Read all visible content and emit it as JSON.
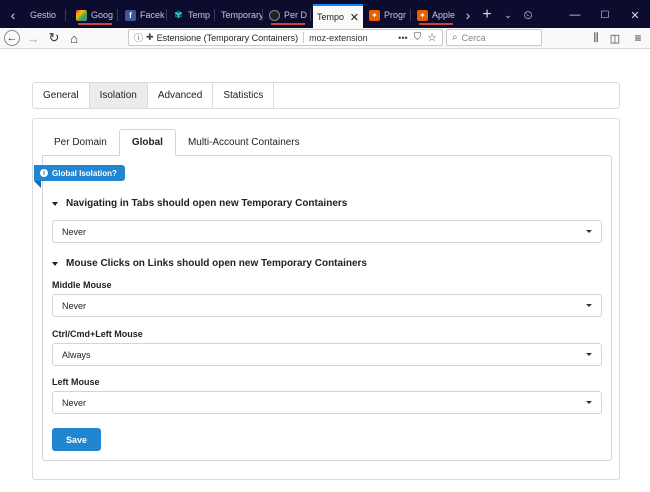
{
  "browser": {
    "tabs": [
      {
        "label": "Gestio",
        "icon": "back-arrow-icon"
      },
      {
        "label": "Goog",
        "icon": "google-photos-icon"
      },
      {
        "label": "Facek",
        "icon": "facebook-icon"
      },
      {
        "label": "Temp",
        "icon": "temporary-containers-icon"
      },
      {
        "label": "Temporary",
        "icon": ""
      },
      {
        "label": "Per D",
        "icon": "github-icon"
      },
      {
        "label": "Tempo",
        "icon": ""
      },
      {
        "label": "Progr",
        "icon": "firefox-addon-icon"
      },
      {
        "label": "Apple",
        "icon": "firefox-addon-icon"
      }
    ],
    "url_identity": "Estensione (Temporary Containers)",
    "url_text": "moz-extension",
    "url_more": "•••",
    "search_placeholder": "Cerca"
  },
  "settings": {
    "top_tabs": [
      "General",
      "Isolation",
      "Advanced",
      "Statistics"
    ],
    "active_top_tab": "Isolation",
    "sub_tabs": [
      "Per Domain",
      "Global",
      "Multi-Account Containers"
    ],
    "active_sub_tab": "Global",
    "ribbon_label": "Global Isolation?",
    "section_navigating": "Navigating in Tabs should open new Temporary Containers",
    "navigating_value": "Never",
    "section_mouse": "Mouse Clicks on Links should open new Temporary Containers",
    "middle_mouse_label": "Middle Mouse",
    "middle_mouse_value": "Never",
    "ctrl_mouse_label": "Ctrl/Cmd+Left Mouse",
    "ctrl_mouse_value": "Always",
    "left_mouse_label": "Left Mouse",
    "left_mouse_value": "Never",
    "save_label": "Save"
  },
  "colors": {
    "accent": "#2185d0",
    "tabbar": "#0c0c2e",
    "active_tab_line": "#0a84ff"
  }
}
